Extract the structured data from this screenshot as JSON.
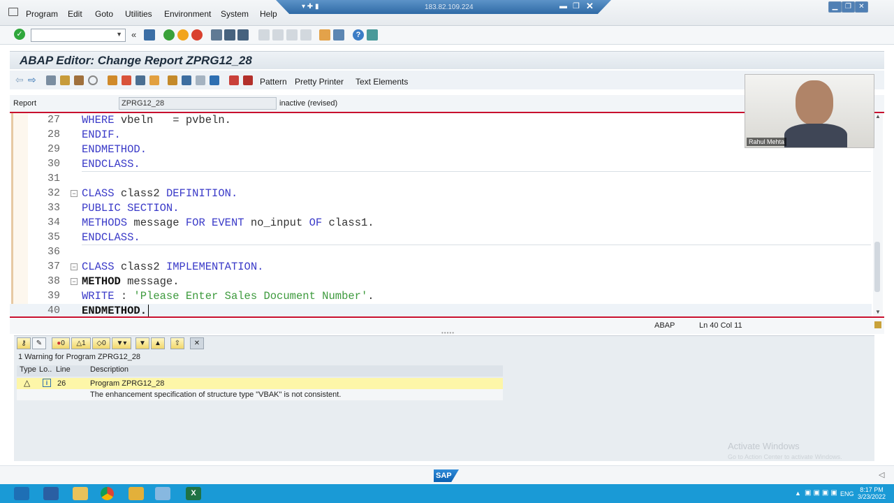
{
  "menu": {
    "items": [
      "Program",
      "Edit",
      "Goto",
      "Utilities",
      "Environment",
      "System",
      "Help"
    ],
    "connection_ip": "183.82.109.224"
  },
  "title": "ABAP Editor: Change Report ZPRG12_28",
  "app_toolbar": {
    "pattern": "Pattern",
    "pretty_printer": "Pretty Printer",
    "text_elements": "Text Elements"
  },
  "report": {
    "label": "Report",
    "value": "ZPRG12_28",
    "status": "inactive (revised)"
  },
  "editor": {
    "lines": [
      {
        "num": "27"
      },
      {
        "num": "28"
      },
      {
        "num": "29"
      },
      {
        "num": "30"
      },
      {
        "num": "31"
      },
      {
        "num": "32"
      },
      {
        "num": "33"
      },
      {
        "num": "34"
      },
      {
        "num": "35"
      },
      {
        "num": "36"
      },
      {
        "num": "37"
      },
      {
        "num": "38"
      },
      {
        "num": "39"
      },
      {
        "num": "40"
      }
    ],
    "code": {
      "l27_a": "WHERE",
      "l27_b": " vbeln   = pvbeln.",
      "l28": "ENDIF.",
      "l29": "ENDMETHOD.",
      "l30": "ENDCLASS.",
      "l32_a": "CLASS",
      "l32_b": " class2 ",
      "l32_c": "DEFINITION.",
      "l33": "PUBLIC SECTION.",
      "l34_a": "METHODS",
      "l34_b": " message ",
      "l34_c": "FOR EVENT",
      "l34_d": " no_input ",
      "l34_e": "OF",
      "l34_f": " class1.",
      "l35": "ENDCLASS.",
      "l37_a": "CLASS",
      "l37_b": " class2 ",
      "l37_c": "IMPLEMENTATION.",
      "l38_a": "METHOD",
      "l38_b": " message.",
      "l39_a": "WRITE",
      "l39_b": " : ",
      "l39_c": "'Please Enter Sales Document Number'",
      "l39_d": ".",
      "l40": "ENDMETHOD."
    }
  },
  "status_bar": {
    "language": "ABAP",
    "position": "Ln  40 Col  11"
  },
  "webcam": {
    "name": "Rahul Mehta"
  },
  "errors": {
    "toolbar": {
      "errors_count": "0",
      "warnings_count": "1",
      "info_count": "0"
    },
    "summary": "1 Warning for Program ZPRG12_28",
    "columns": [
      "Type",
      "Lo..",
      "Line",
      "Description"
    ],
    "rows": [
      {
        "line": "26",
        "description": "Program ZPRG12_28"
      },
      {
        "line": "",
        "description": "The enhancement specification of structure type \"VBAK\" is not consistent."
      }
    ]
  },
  "watermark": {
    "title": "Activate Windows",
    "subtitle": "Go to Action Center to activate Windows."
  },
  "taskbar": {
    "language": "ENG",
    "time": "8:17 PM",
    "date": "3/23/2022"
  },
  "colors": {
    "keyword": "#3a3ac8",
    "string": "#3d9a3d",
    "editor_border": "#c8102e",
    "warning_row": "#fdf6a8",
    "taskbar": "#1a9ad6"
  }
}
